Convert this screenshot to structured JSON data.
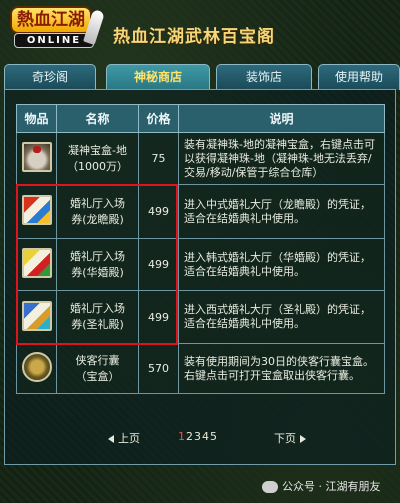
{
  "header": {
    "logo_top_text": "熱血江湖",
    "logo_bottom_text": "ONLINE",
    "title": "热血江湖武林百宝阁"
  },
  "tabs": [
    {
      "label": "奇珍阁",
      "active": false
    },
    {
      "label": "神秘商店",
      "active": true
    },
    {
      "label": "装饰店",
      "active": false
    },
    {
      "label": "使用帮助",
      "active": false
    }
  ],
  "table": {
    "headers": {
      "icon": "物品",
      "name": "名称",
      "price": "价格",
      "desc": "说明"
    },
    "rows": [
      {
        "icon": "bag-icon",
        "name_line1": "凝神宝盒-地",
        "name_line2": "（1000万）",
        "price": "75",
        "desc": "装有凝神珠-地的凝神宝盒，右键点击可以获得凝神珠-地（凝神珠-地无法丢弃/交易/移动/保管于综合仓库）"
      },
      {
        "icon": "wedding-ticket-icon",
        "name_line1": "婚礼厅入场",
        "name_line2": "券(龙瞻殿)",
        "price": "499",
        "desc": "进入中式婚礼大厅（龙瞻殿）的凭证，适合在结婚典礼中使用。"
      },
      {
        "icon": "wedding-ticket-icon",
        "name_line1": "婚礼厅入场",
        "name_line2": "券(华婚殿)",
        "price": "499",
        "desc": "进入韩式婚礼大厅（华婚殿）的凭证，适合在结婚典礼中使用。"
      },
      {
        "icon": "wedding-ticket-icon",
        "name_line1": "婚礼厅入场",
        "name_line2": "券(圣礼殿)",
        "price": "499",
        "desc": "进入西式婚礼大厅（圣礼殿）的凭证，适合在结婚典礼中使用。"
      },
      {
        "icon": "treasure-box-icon",
        "name_line1": "侠客行囊",
        "name_line2": "（宝盒）",
        "price": "570",
        "desc": "装有使用期间为30日的侠客行囊宝盒。右键点击可打开宝盒取出侠客行囊。"
      }
    ]
  },
  "pager": {
    "prev_label": "上页",
    "next_label": "下页",
    "current_page": "1",
    "other_pages": "2345"
  },
  "watermark": "公众号 · 江湖有朋友",
  "colors": {
    "highlight_border": "#e0141c",
    "active_tab_text": "#ffe36a",
    "title_gold": "#f5d77a"
  }
}
